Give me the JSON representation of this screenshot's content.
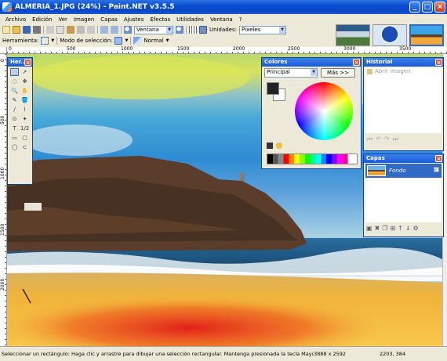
{
  "window": {
    "title": "ALMERIA_1.JPG (24%) - Paint.NET v3.5.5"
  },
  "window_buttons": [
    "_",
    "□",
    "×"
  ],
  "menu": [
    "Archivo",
    "Edición",
    "Ver",
    "Imagen",
    "Capas",
    "Ajustes",
    "Efectos",
    "Utilidades",
    "Ventana",
    "?"
  ],
  "toolbar": {
    "zoom_mode": "Ventana",
    "units_label": "Unidades:",
    "units_value": "Píxeles"
  },
  "tool_options": {
    "tool_label": "Herramienta:",
    "selection_mode_label": "Modo de selección:",
    "blend_mode": "Normal"
  },
  "ruler": {
    "h_ticks": [
      "0",
      "500",
      "1000",
      "1500",
      "2000",
      "2500",
      "3000",
      "3500"
    ],
    "v_ticks": [
      "0",
      "500",
      "1000",
      "1500",
      "2000"
    ]
  },
  "tools_palette": {
    "title": "Her...",
    "tools": [
      "⬚",
      "➚",
      "◌",
      "✥",
      "🔍",
      "✋",
      "✎",
      "🪣",
      "∕",
      "⌇",
      "⊙",
      "✦",
      "T",
      "1/2",
      "▭",
      "▢",
      "◯",
      "⊂"
    ]
  },
  "colors_palette": {
    "title": "Colores",
    "target": "Principal",
    "more_button": "Más >>",
    "primary_color": "#222222",
    "secondary_color": "#ffffff"
  },
  "history_palette": {
    "title": "Historial",
    "items": [
      "Abrir imagen"
    ]
  },
  "layers_palette": {
    "title": "Capas",
    "layers": [
      {
        "name": "Fondo",
        "visible": true
      }
    ]
  },
  "status": {
    "message": "Seleccionar un rectángulo: Haga clic y arrastre para dibujar una selección rectangular. Mantenga presionada la tecla Mayúsculas para resta",
    "image_size": "3888 x 2592",
    "cursor_position": "2203, 384"
  }
}
